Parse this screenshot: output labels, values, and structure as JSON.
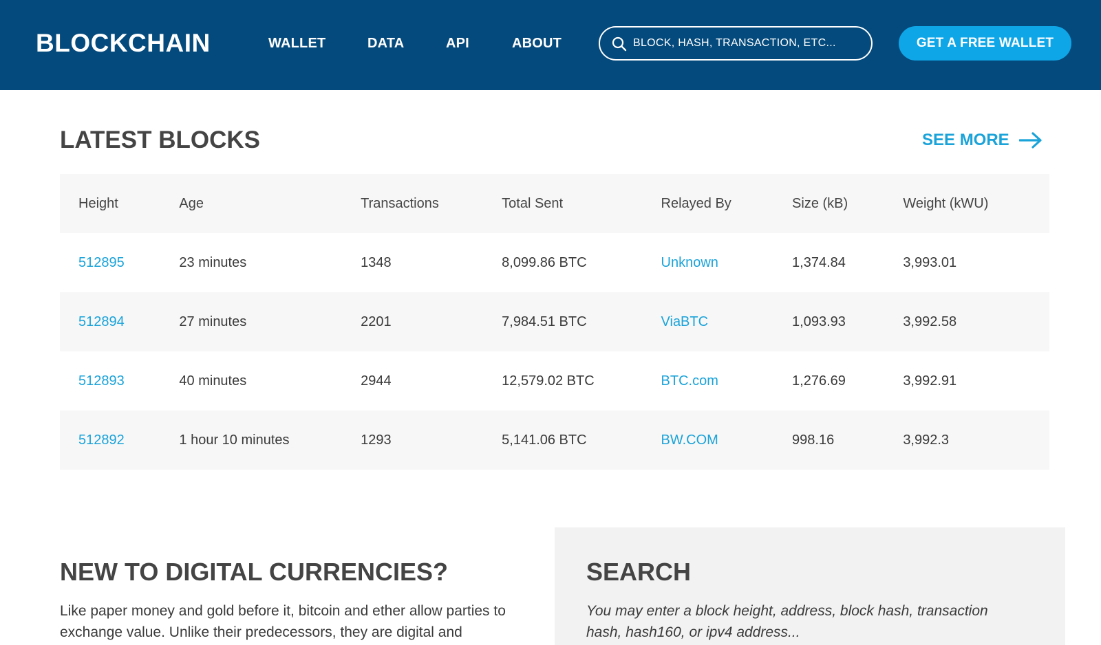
{
  "header": {
    "logo": "BLOCKCHAIN",
    "nav": [
      "WALLET",
      "DATA",
      "API",
      "ABOUT"
    ],
    "search_placeholder": "BLOCK, HASH, TRANSACTION, ETC...",
    "cta_label": "GET A FREE WALLET"
  },
  "latest_blocks": {
    "title": "LATEST BLOCKS",
    "see_more": "SEE MORE",
    "columns": [
      "Height",
      "Age",
      "Transactions",
      "Total Sent",
      "Relayed By",
      "Size (kB)",
      "Weight (kWU)"
    ],
    "rows": [
      {
        "height": "512895",
        "age": "23 minutes",
        "transactions": "1348",
        "total_sent": "8,099.86 BTC",
        "relayed_by": "Unknown",
        "size": "1,374.84",
        "weight": "3,993.01"
      },
      {
        "height": "512894",
        "age": "27 minutes",
        "transactions": "2201",
        "total_sent": "7,984.51 BTC",
        "relayed_by": "ViaBTC",
        "size": "1,093.93",
        "weight": "3,992.58"
      },
      {
        "height": "512893",
        "age": "40 minutes",
        "transactions": "2944",
        "total_sent": "12,579.02 BTC",
        "relayed_by": "BTC.com",
        "size": "1,276.69",
        "weight": "3,992.91"
      },
      {
        "height": "512892",
        "age": "1 hour 10 minutes",
        "transactions": "1293",
        "total_sent": "5,141.06 BTC",
        "relayed_by": "BW.COM",
        "size": "998.16",
        "weight": "3,992.3"
      }
    ]
  },
  "new_to_digital": {
    "title": "NEW TO DIGITAL CURRENCIES?",
    "text": "Like paper money and gold before it, bitcoin and ether allow parties to exchange value. Unlike their predecessors, they are digital and"
  },
  "search_panel": {
    "title": "SEARCH",
    "text": "You may enter a block height, address, block hash, transaction hash, hash160, or ipv4 address..."
  },
  "colors": {
    "header_bg": "#054a7c",
    "accent": "#1aa3d9",
    "cta_bg": "#0fa6e8"
  }
}
